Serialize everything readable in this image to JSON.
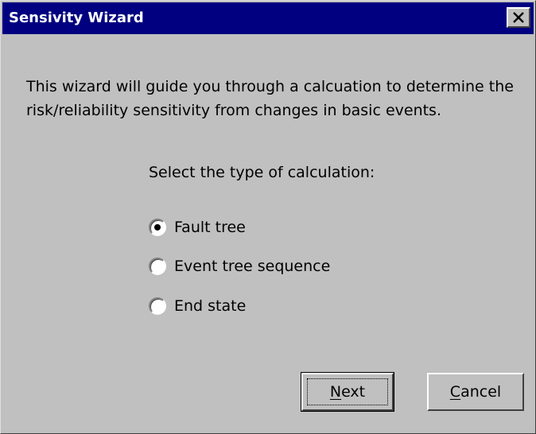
{
  "window": {
    "title": "Sensivity Wizard",
    "close_icon": "close-icon"
  },
  "content": {
    "intro_line1": "This wizard will guide you through a calcuation to determine the",
    "intro_line2": "risk/reliability sensitivity from changes in basic events.",
    "prompt": "Select the type of calculation:"
  },
  "options": [
    {
      "label": "Fault tree",
      "selected": true
    },
    {
      "label": "Event tree sequence",
      "selected": false
    },
    {
      "label": "End state",
      "selected": false
    }
  ],
  "buttons": {
    "next_mnemonic": "N",
    "next_rest": "ext",
    "cancel_mnemonic": "C",
    "cancel_rest": "ancel"
  },
  "colors": {
    "titlebar": "#000080",
    "face": "#c0c0c0"
  }
}
